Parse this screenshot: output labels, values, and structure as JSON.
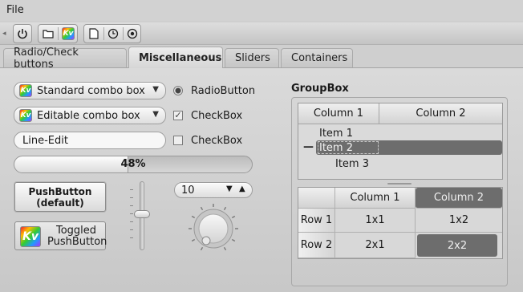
{
  "menubar": {
    "file": "File"
  },
  "toolbar": {
    "buttons": [
      {
        "icon": "power-icon"
      },
      {
        "icon": "folder-icon"
      },
      {
        "icon": "kv-logo-icon"
      },
      {
        "icon": "document-icon"
      },
      {
        "icon": "clock-icon"
      },
      {
        "icon": "target-icon"
      }
    ]
  },
  "tabs": [
    {
      "label": "Radio/Check buttons",
      "active": false
    },
    {
      "label": "Miscellaneous",
      "active": true
    },
    {
      "label": "Sliders",
      "active": false
    },
    {
      "label": "Containers",
      "active": false
    }
  ],
  "misc": {
    "standard_combo": "Standard combo box",
    "editable_combo": "Editable combo box",
    "line_edit": "Line-Edit",
    "progress": {
      "value": 0.48,
      "text": "48%"
    },
    "pushbutton_line1": "PushButton",
    "pushbutton_line2": "(default)",
    "toggled_line1": "Toggled",
    "toggled_line2": "PushButton",
    "radio_label": "RadioButton",
    "radio_checked": true,
    "check1_label": "CheckBox",
    "check1_checked": true,
    "check2_label": "CheckBox",
    "check2_checked": false,
    "slider_value": 0.5,
    "spinbox_value": "10"
  },
  "groupbox": {
    "title": "GroupBox",
    "tree": {
      "columns": [
        "Column 1",
        "Column 2"
      ],
      "items": [
        "Item 1",
        "Item 2",
        "Item 3"
      ],
      "selected": "Item 2"
    },
    "table": {
      "columns": [
        "Column 1",
        "Column 2"
      ],
      "rows": [
        {
          "header": "Row 1",
          "cells": [
            "1x1",
            "1x2"
          ]
        },
        {
          "header": "Row 2",
          "cells": [
            "2x1",
            "2x2"
          ]
        }
      ],
      "selected_cell": "2x2"
    }
  },
  "colors": {
    "selection": "#6d6d6d",
    "background": "#cfcfcf"
  }
}
